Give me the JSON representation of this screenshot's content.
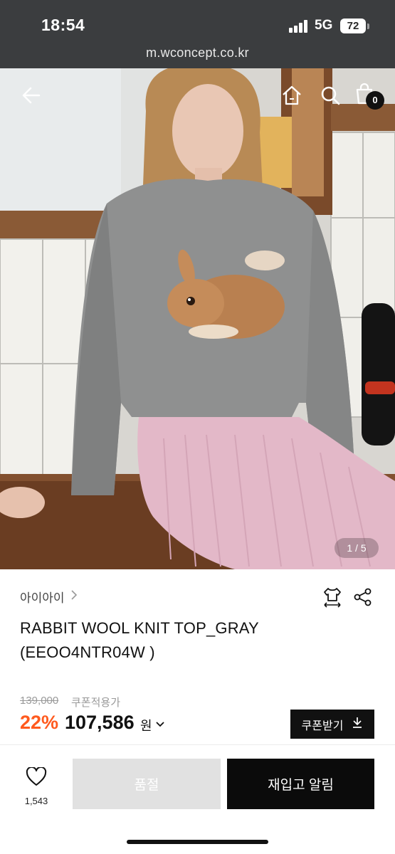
{
  "status_bar": {
    "time": "18:54",
    "network": "5G",
    "battery": "72"
  },
  "browser": {
    "url": "m.wconcept.co.kr"
  },
  "hero": {
    "image_counter": "1 / 5",
    "cart_count": "0"
  },
  "product": {
    "brand": "아이아이",
    "title": "RABBIT WOOL KNIT TOP_GRAY (EEOO4NTR04W )",
    "original_price": "139,000",
    "coupon_applied_label": "쿠폰적용가",
    "discount": "22%",
    "final_price": "107,586",
    "currency": "원",
    "coupon_button": "쿠폰받기"
  },
  "bottom_bar": {
    "like_count": "1,543",
    "soldout_label": "품절",
    "restock_label": "재입고 알림"
  },
  "icons": [
    "back-arrow-icon",
    "home-icon",
    "search-icon",
    "cart-icon",
    "hanger-size-icon",
    "share-icon",
    "heart-icon",
    "download-icon",
    "chevron-right-icon",
    "chevron-down-icon"
  ],
  "colors": {
    "accent_discount": "#ff5a1e",
    "chrome": "#3b3d3f",
    "primary_button": "#0b0b0b",
    "disabled_button": "#e1e1e1"
  }
}
